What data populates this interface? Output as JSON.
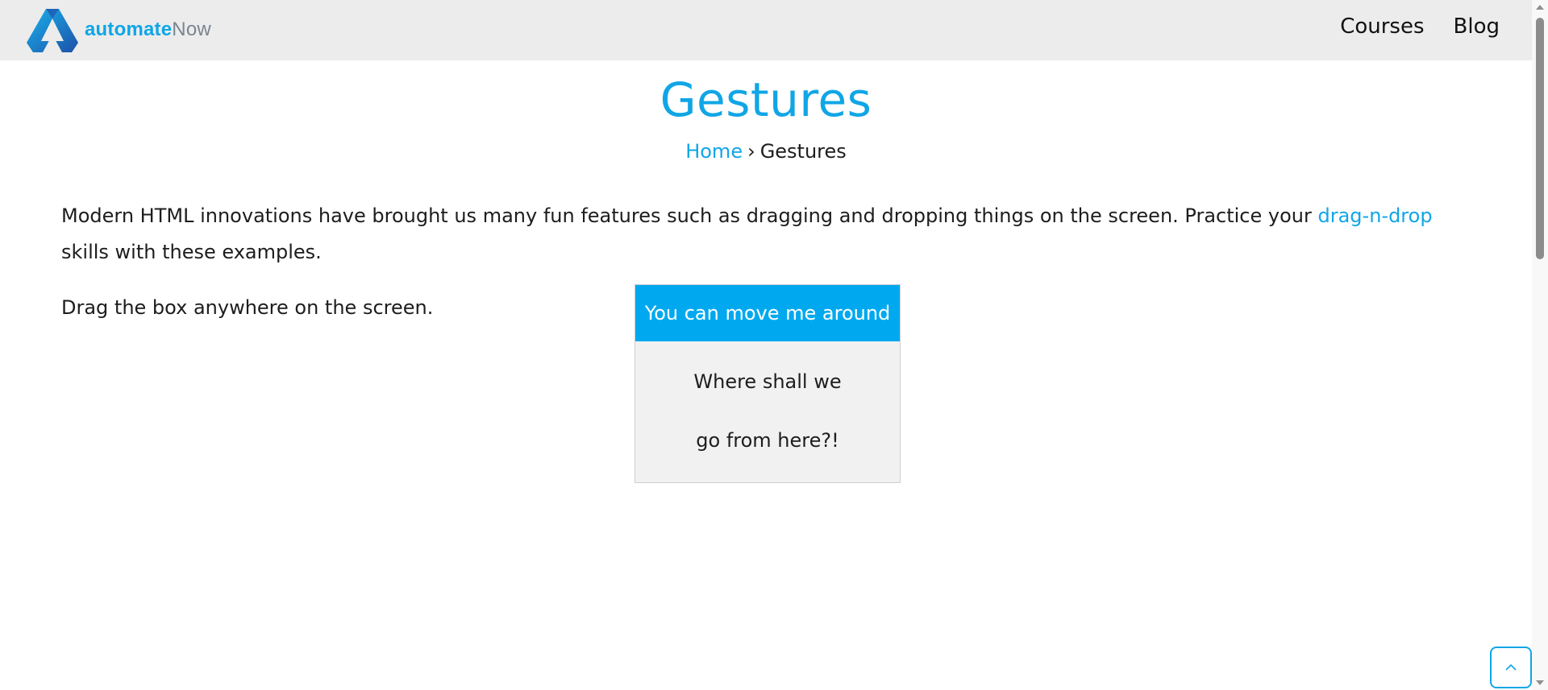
{
  "header": {
    "logo": {
      "brand_bold": "automate",
      "brand_light": "Now",
      "icon": "automatenow-logo-icon"
    },
    "nav": {
      "courses": "Courses",
      "blog": "Blog"
    }
  },
  "page": {
    "title": "Gestures",
    "breadcrumb": {
      "home": "Home",
      "separator": "›",
      "current": "Gestures"
    },
    "intro": {
      "text_before": "Modern HTML innovations have brought us many fun features such as dragging and dropping things on the screen. Practice your ",
      "link": "drag-n-drop",
      "text_after": " skills with these examples."
    },
    "instruction": "Drag the box anywhere on the screen.",
    "drag_box": {
      "header": "You can move me around",
      "line1": "Where shall we",
      "line2": "go from here?!"
    }
  },
  "back_to_top": {
    "icon": "chevron-up-icon"
  },
  "colors": {
    "accent": "#10a6e6",
    "drag_header_bg": "#00a9ef",
    "header_bg": "#ececec",
    "drag_body_bg": "#f1f1f1"
  }
}
